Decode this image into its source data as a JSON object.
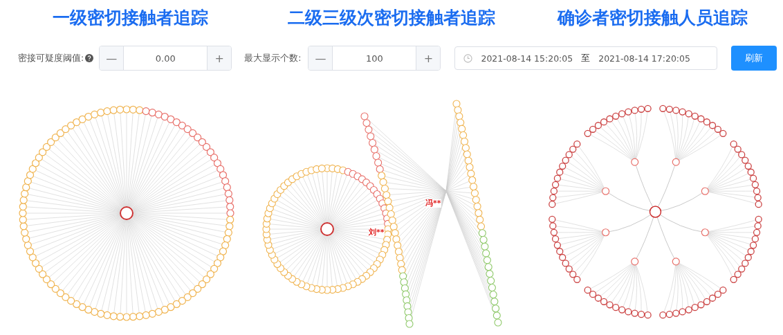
{
  "panels": [
    {
      "title": "一级密切接触者追踪"
    },
    {
      "title": "二级三级次密切接触者追踪",
      "labels": [
        "刘**",
        "冯**"
      ]
    },
    {
      "title": "确诊者密切接触人员追踪"
    }
  ],
  "controls": {
    "threshold": {
      "label": "密接可疑度阈值:",
      "value": "0.00",
      "minus": "—",
      "plus": "+"
    },
    "max_count": {
      "label": "最大显示个数:",
      "value": "100",
      "minus": "—",
      "plus": "+"
    },
    "date_range": {
      "start": "2021-08-14 15:20:05",
      "separator": "至",
      "end": "2021-08-14 17:20:05"
    },
    "refresh_button": "刷新"
  }
}
